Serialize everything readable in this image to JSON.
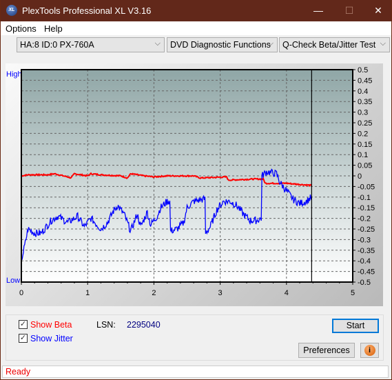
{
  "window": {
    "title": "PlexTools Professional XL V3.16",
    "logo_text": "XL",
    "minimize": "—",
    "maximize": "☐",
    "close": "✕"
  },
  "menu": [
    {
      "label": "Options"
    },
    {
      "label": "Help"
    }
  ],
  "toolbar": {
    "drive": "HA:8 ID:0  PX-760A",
    "function": "DVD Diagnostic Functions",
    "test": "Q-Check Beta/Jitter Test"
  },
  "chart_data": {
    "type": "line",
    "xlim": [
      0,
      5
    ],
    "ylim": [
      -0.5,
      0.5
    ],
    "x_ticks": [
      "0",
      "1",
      "2",
      "3",
      "4",
      "5"
    ],
    "y_ticks": [
      "0.5",
      "0.45",
      "0.4",
      "0.35",
      "0.3",
      "0.25",
      "0.2",
      "0.15",
      "0.1",
      "0.05",
      "0",
      "-0.05",
      "-0.1",
      "-0.15",
      "-0.2",
      "-0.25",
      "-0.3",
      "-0.35",
      "-0.4",
      "-0.45",
      "-0.5"
    ],
    "left_labels": {
      "top": "High",
      "bottom": "Low"
    },
    "grid": true,
    "cursor_x": 4.38,
    "series": [
      {
        "key": "beta",
        "color": "#ff0000",
        "points": [
          [
            0,
            0.0
          ],
          [
            0.1,
            0.005
          ],
          [
            0.4,
            0.005
          ],
          [
            0.5,
            0.01
          ],
          [
            0.7,
            -0.005
          ],
          [
            0.75,
            -0.01
          ],
          [
            0.8,
            0.01
          ],
          [
            1.0,
            0.0
          ],
          [
            1.05,
            0.01
          ],
          [
            1.2,
            0.005
          ],
          [
            1.5,
            0.0
          ],
          [
            1.6,
            -0.01
          ],
          [
            1.65,
            0.01
          ],
          [
            1.85,
            0.0
          ],
          [
            2.0,
            -0.005
          ],
          [
            2.2,
            0.0
          ],
          [
            2.6,
            0.0
          ],
          [
            2.7,
            -0.01
          ],
          [
            3.1,
            -0.005
          ],
          [
            3.12,
            -0.02
          ],
          [
            3.5,
            -0.015
          ],
          [
            3.65,
            -0.015
          ],
          [
            3.68,
            -0.035
          ],
          [
            4.0,
            -0.035
          ],
          [
            4.38,
            -0.045
          ]
        ]
      },
      {
        "key": "jitter",
        "color": "#0000ff",
        "points": [
          [
            0,
            -0.4
          ],
          [
            0.05,
            -0.33
          ],
          [
            0.1,
            -0.25
          ],
          [
            0.2,
            -0.27
          ],
          [
            0.3,
            -0.27
          ],
          [
            0.45,
            -0.21
          ],
          [
            0.55,
            -0.19
          ],
          [
            0.7,
            -0.22
          ],
          [
            0.85,
            -0.19
          ],
          [
            0.95,
            -0.24
          ],
          [
            1.05,
            -0.2
          ],
          [
            1.2,
            -0.25
          ],
          [
            1.3,
            -0.22
          ],
          [
            1.4,
            -0.16
          ],
          [
            1.45,
            -0.14
          ],
          [
            1.55,
            -0.18
          ],
          [
            1.65,
            -0.26
          ],
          [
            1.75,
            -0.18
          ],
          [
            1.8,
            -0.24
          ],
          [
            1.9,
            -0.17
          ],
          [
            1.95,
            -0.23
          ],
          [
            2.05,
            -0.19
          ],
          [
            2.1,
            -0.15
          ],
          [
            2.2,
            -0.12
          ],
          [
            2.24,
            -0.12
          ],
          [
            2.25,
            -0.26
          ],
          [
            2.35,
            -0.25
          ],
          [
            2.45,
            -0.22
          ],
          [
            2.5,
            -0.15
          ],
          [
            2.6,
            -0.12
          ],
          [
            2.75,
            -0.11
          ],
          [
            2.77,
            -0.11
          ],
          [
            2.78,
            -0.27
          ],
          [
            2.85,
            -0.24
          ],
          [
            2.95,
            -0.16
          ],
          [
            3.05,
            -0.12
          ],
          [
            3.15,
            -0.12
          ],
          [
            3.25,
            -0.14
          ],
          [
            3.35,
            -0.18
          ],
          [
            3.45,
            -0.21
          ],
          [
            3.55,
            -0.21
          ],
          [
            3.62,
            -0.2
          ],
          [
            3.63,
            0.0
          ],
          [
            3.7,
            0.02
          ],
          [
            3.85,
            0.01
          ],
          [
            3.9,
            -0.03
          ],
          [
            3.95,
            -0.05
          ],
          [
            4.0,
            -0.07
          ],
          [
            4.1,
            -0.11
          ],
          [
            4.2,
            -0.13
          ],
          [
            4.3,
            -0.12
          ],
          [
            4.38,
            -0.1
          ]
        ]
      }
    ]
  },
  "controls": {
    "show_beta": "Show Beta",
    "show_jitter": "Show Jitter",
    "show_beta_checked": true,
    "show_jitter_checked": true,
    "lsn_label": "LSN:",
    "lsn_value": "2295040",
    "start": "Start",
    "preferences": "Preferences",
    "info_icon": "i"
  },
  "status": "Ready"
}
